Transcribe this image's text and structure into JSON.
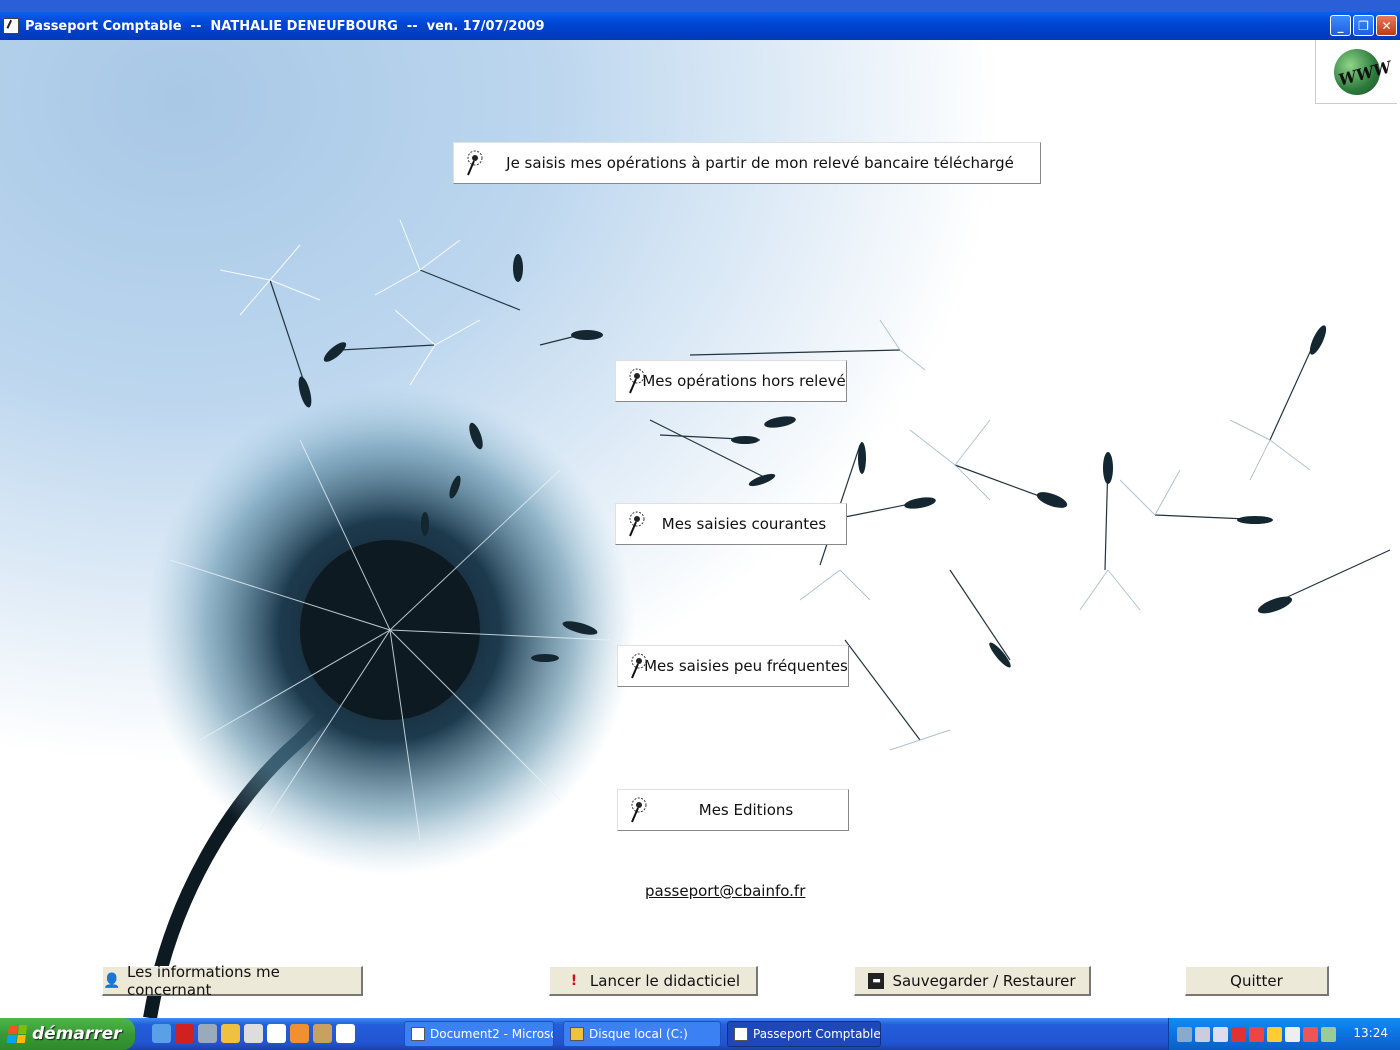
{
  "window": {
    "title": "Passeport Comptable  --  NATHALIE DENEUFBOURG  --  ven. 17/07/2009"
  },
  "header": {
    "www_logo": "WWW"
  },
  "menu": {
    "telecharge": "Je saisis mes opérations à partir de mon relevé bancaire téléchargé",
    "hors_releve": "Mes opérations hors relevé",
    "courantes": "Mes saisies courantes",
    "peu_frequentes": "Mes saisies peu fréquentes",
    "editions": "Mes Editions"
  },
  "contact": {
    "email": "passeport@cbainfo.fr"
  },
  "bottom": {
    "infos": "Les informations me concernant",
    "didacticiel": "Lancer le didacticiel",
    "sauvegarder": "Sauvegarder / Restaurer",
    "quitter": "Quitter"
  },
  "taskbar": {
    "start": "démarrer",
    "tasks": [
      "Document2 - Microsof...",
      "Disque local (C:)",
      "Passeport Comptable"
    ],
    "clock": "13:24"
  },
  "colors": {
    "titlebar": "#0046d5",
    "taskbar": "#245edb",
    "start": "#3a9a36",
    "sky": "#a8c8e6"
  }
}
